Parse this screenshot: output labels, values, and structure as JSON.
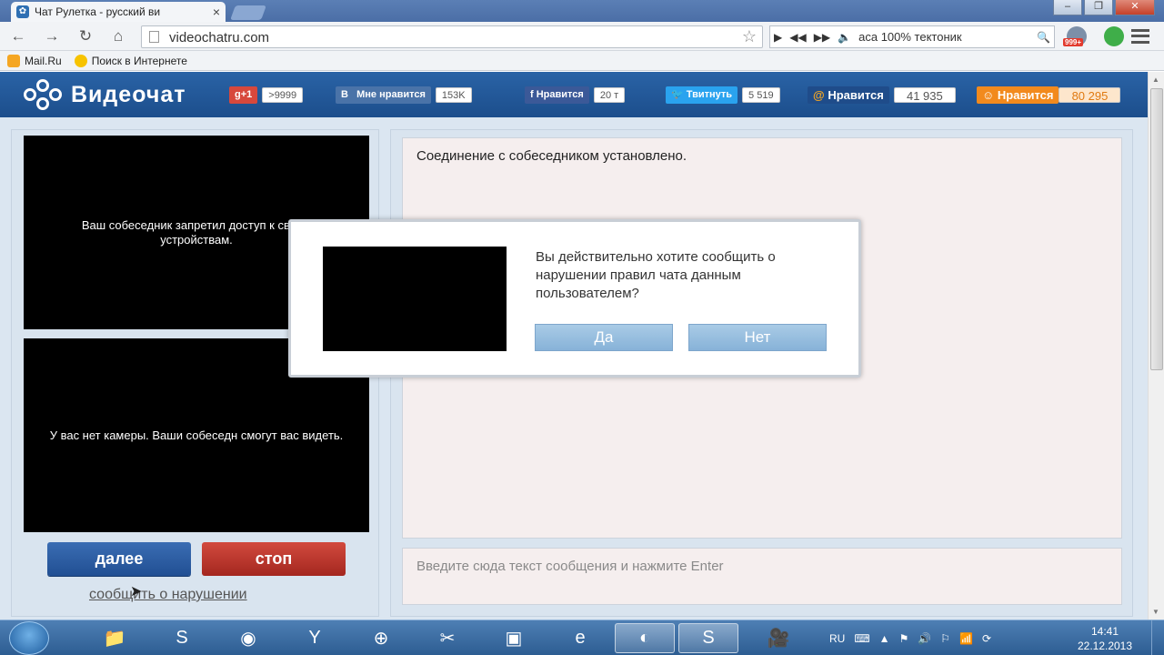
{
  "browser": {
    "tab_title": "Чат Рулетка - русский ви",
    "url": "videochatru.com",
    "media_track": "аса 100% тектоник",
    "badge": "999+",
    "bookmarks": [
      "Mail.Ru",
      "Поиск в Интернете"
    ]
  },
  "site": {
    "logo_text": "Видеочат",
    "social": [
      {
        "label": "g+1",
        "count": ">9999",
        "color": "#d7483c"
      },
      {
        "label": "Мне нравится",
        "prefix": "В",
        "count": "153K",
        "color": "#4a73a8"
      },
      {
        "label": "Нравится",
        "prefix": "f",
        "count": "20 т",
        "color": "#3b5998"
      },
      {
        "label": "Твитнуть",
        "count": "5 519",
        "color": "#2aa3ef"
      },
      {
        "label": "Нравится",
        "prefix": "@",
        "count": "41 935",
        "color": "#1f4c8a"
      },
      {
        "label": "Нравится",
        "count": "80 295",
        "color": "#f28a1d"
      }
    ]
  },
  "left": {
    "partner_video_text": "Ваш собеседник запретил доступ к своим устройствам.",
    "my_video_text": "У вас нет камеры. Ваши собеседн смогут вас видеть.",
    "next_label": "далее",
    "stop_label": "стоп",
    "report_label": "сообщить о нарушении"
  },
  "chat": {
    "status_message": "Соединение с собеседником установлено.",
    "input_placeholder": "Введите сюда текст сообщения и нажмите Enter"
  },
  "modal": {
    "question": "Вы действительно хотите сообщить о нарушении правил чата данным пользователем?",
    "yes_label": "Да",
    "no_label": "Нет"
  },
  "taskbar": {
    "lang": "RU",
    "time": "14:41",
    "date": "22.12.2013"
  }
}
